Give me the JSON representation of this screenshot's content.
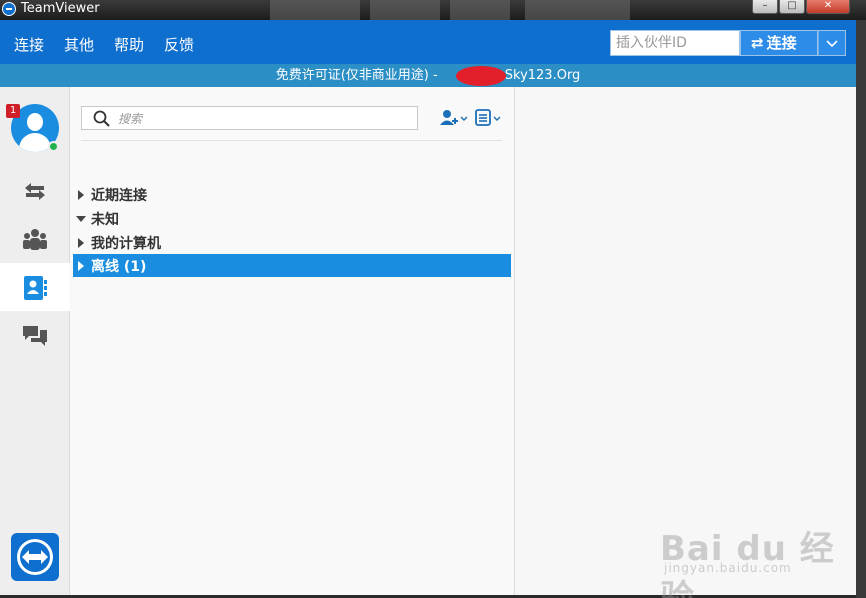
{
  "window": {
    "title": "TeamViewer"
  },
  "menubar": {
    "items": [
      "连接",
      "其他",
      "帮助",
      "反馈"
    ],
    "partner_id_placeholder": "插入伙伴ID",
    "connect_label": "连接"
  },
  "license_bar": {
    "text": "免费许可证(仅非商业用途) - ",
    "suffix": " - Sky123.Org"
  },
  "leftnav": {
    "notification_count": "1",
    "status": "online",
    "tabs": [
      "arrows-icon",
      "group-icon",
      "contacts-icon",
      "chat-icon"
    ],
    "active_tab": "contacts-icon"
  },
  "contacts": {
    "search_placeholder": "搜索",
    "groups": [
      {
        "label": "近期连接",
        "expanded": false
      },
      {
        "label": "未知",
        "expanded": true
      },
      {
        "label": "我的计算机",
        "expanded": false
      },
      {
        "label": "离线 (1)",
        "expanded": false,
        "selected": true
      }
    ]
  },
  "colors": {
    "brand_blue": "#0e6fcf",
    "license_bar": "#2b8fc6",
    "selection": "#1b8de0",
    "online": "#22b14c",
    "badge": "#d11f2a"
  },
  "watermark": {
    "brand": "Bai du 经验",
    "url": "jingyan.baidu.com"
  }
}
